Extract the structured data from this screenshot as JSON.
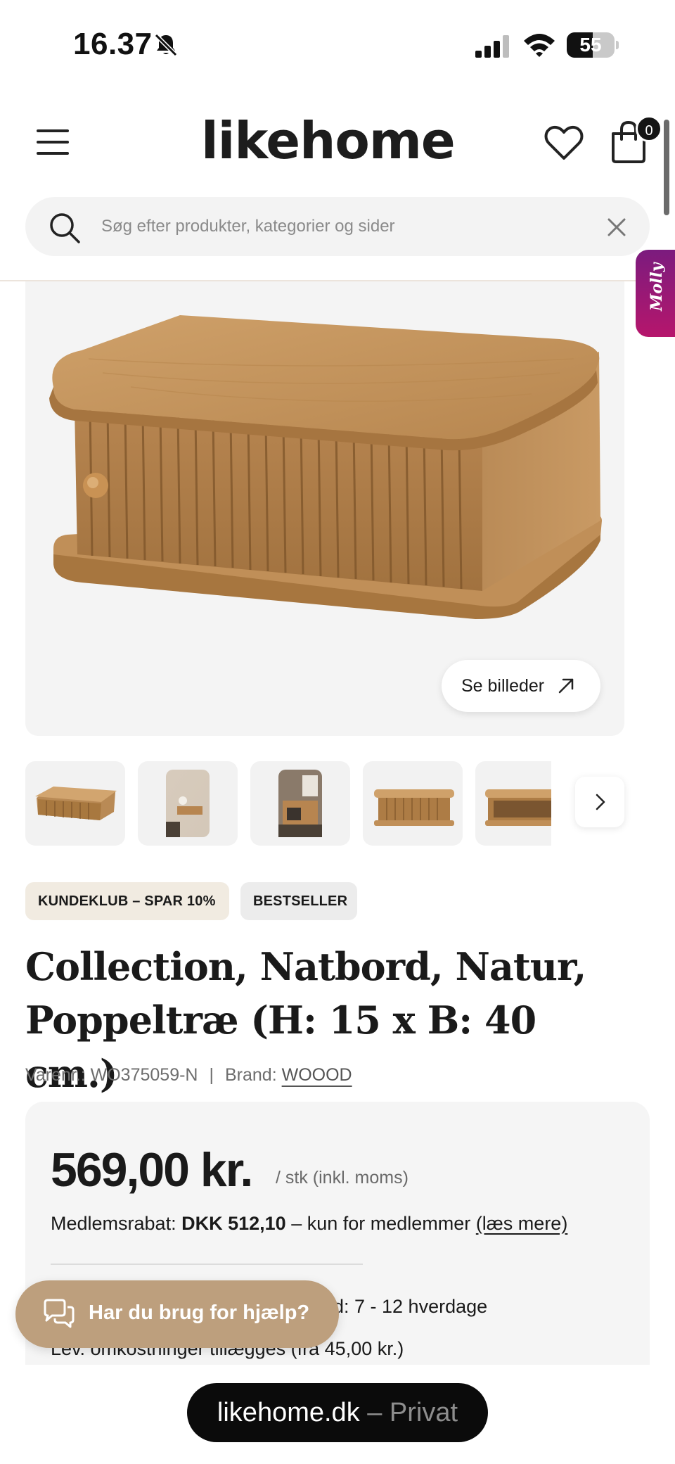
{
  "status_bar": {
    "time": "16.37",
    "battery": "55",
    "battery_level": 0.55,
    "icons": [
      "bell-slash-icon",
      "signal-icon",
      "wifi-icon",
      "battery-icon"
    ]
  },
  "header": {
    "logo": "likehome",
    "cart_count": "0",
    "icons": [
      "menu-icon",
      "heart-icon",
      "cart-icon"
    ]
  },
  "search": {
    "placeholder": "Søg efter produkter, kategorier og sider",
    "icons": [
      "search-icon",
      "close-icon"
    ]
  },
  "molly": {
    "label": "Molly"
  },
  "gallery": {
    "see_images_label": "Se billeder",
    "thumbnail_count": 5
  },
  "badges": {
    "club": "KUNDEKLUB – SPAR 10%",
    "bestseller": "BESTSELLER"
  },
  "product": {
    "title": "Collection, Natbord, Natur, Poppeltræ (H: 15 x B: 40 cm.)",
    "sku_label": "Varenr.: WO375059-N",
    "separator": "|",
    "brand_label": "Brand:",
    "brand": "WOOOD"
  },
  "pricing": {
    "price": "569,00 kr.",
    "unit": "/ stk (inkl. moms)",
    "member_prefix": "Medlemsrabat:",
    "member_amount": "DKK 512,10",
    "member_suffix": "– kun for medlemmer",
    "member_read_more": "(læs mere)",
    "delivery_time_partial": "id: 7 - 12 hverdage",
    "delivery_costs": "Lev. omkostninger tillægges (fra 45,00 kr.)"
  },
  "help": {
    "label": "Har du brug for hjælp?"
  },
  "browser": {
    "domain": "likehome.dk",
    "mode": " – Privat"
  },
  "colors": {
    "accent_help": "#bd9f7d",
    "club_badge": "#f1ebe1",
    "molly_gradient_top": "#7b1b7e",
    "molly_gradient_bottom": "#b6166c"
  }
}
